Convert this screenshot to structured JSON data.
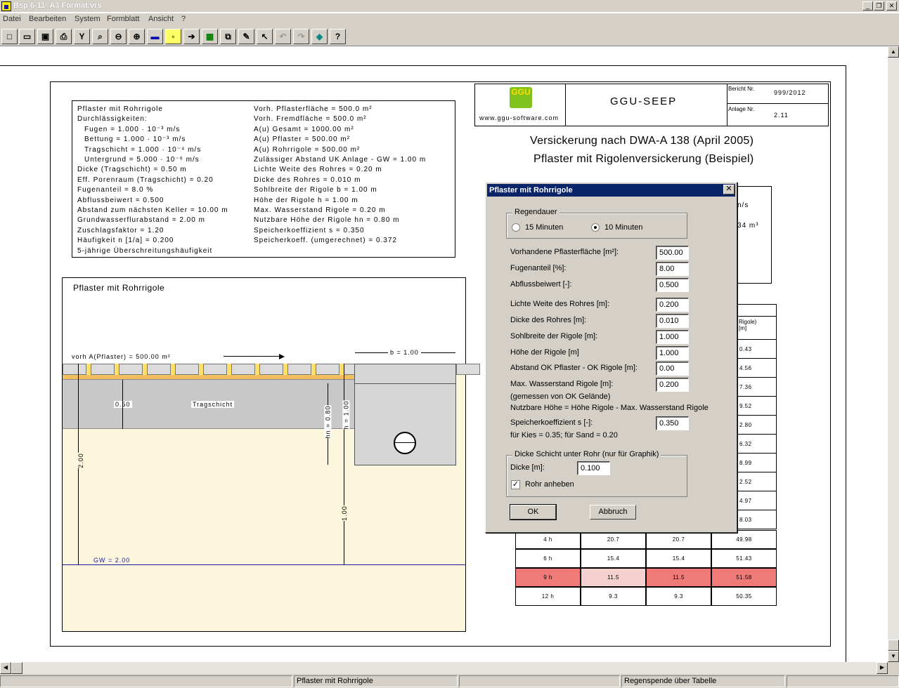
{
  "window": {
    "title": "Bsp 6-11_A3 Format.vrs"
  },
  "menu": [
    "Datei",
    "Bearbeiten",
    "System",
    "Formblatt",
    "Ansicht",
    "?"
  ],
  "report": {
    "logo_text": "GGU",
    "logo_url": "www.ggu-software.com",
    "program": "GGU-SEEP",
    "bericht_label": "Bericht Nr.",
    "bericht_value": "999/2012",
    "anlage_label": "Anlage Nr.",
    "anlage_value": "2.11",
    "heading1": "Versickerung nach DWA-A 138 (April 2005)",
    "heading2": "Pflaster mit Rigolenversickerung (Beispiel)"
  },
  "params_left": [
    "Pflaster mit Rohrrigole",
    "Durchlässigkeiten:",
    "Fugen = 1.000 · 10⁻³ m/s",
    "Bettung = 1.000 · 10⁻³ m/s",
    "Tragschicht = 1.000 · 10⁻⁴ m/s",
    "Untergrund = 5.000 · 10⁻⁶ m/s",
    "Dicke (Tragschicht) = 0.50 m",
    "Eff. Porenraum (Tragschicht) = 0.20",
    "Fugenanteil = 8.0 %",
    "Abflussbeiwert = 0.500",
    "Abstand zum nächsten Keller = 10.00 m",
    "Grundwasserflurabstand = 2.00 m",
    "Zuschlagsfaktor = 1.20",
    "Häufigkeit n [1/a] = 0.200",
    "5-jährige Überschreitungshäufigkeit"
  ],
  "params_right": [
    "Vorh. Pflasterfläche = 500.0 m²",
    "Vorh. Fremdfläche = 500.0 m²",
    "A(u) Gesamt = 1000.00 m²",
    "A(u) Pflaster = 500.00 m²",
    "A(u) Rohrrigole = 500.00 m²",
    "Zulässiger Abstand UK Anlage - GW = 1.00 m",
    "Lichte Weite des Rohres = 0.20 m",
    "Dicke des Rohres = 0.010 m",
    "Sohlbreite der Rigole b = 1.00 m",
    "Höhe der Rigole h = 1.00 m",
    "Max. Wasserstand Rigole = 0.20 m",
    "Nutzbare Höhe der Rigole hn = 0.80 m",
    "Speicherkoeffizient s = 0.350",
    "Speicherkoeff. (umgerechnet) = 0.372"
  ],
  "drawing": {
    "title": "Pflaster mit Rohrrigole",
    "area_label": "vorh A(Pflaster) = 500.00 m²",
    "b_label": "b = 1.00",
    "thick_label": "0.50",
    "layer_label": "Tragschicht",
    "hn_label": "hn = 0.80",
    "h_label": "h = 1.00",
    "depth_label": "2.00",
    "gap_label": "1.00",
    "gw_label": "GW = 2.00"
  },
  "right_box_partial": [
    "n/s",
    "34 m³"
  ],
  "table": {
    "header_partial": "Rigole)",
    "header_unit": "[m]",
    "hidden_col4": [
      "0.43",
      "4.56",
      "7.36",
      "9.52",
      "2.80",
      "6.32",
      "8.99",
      "2.52",
      "4.97",
      "8.03"
    ],
    "rows": [
      {
        "d": "4 h",
        "a": "20.7",
        "b": "20.7",
        "c": "49.98",
        "hl": false
      },
      {
        "d": "6 h",
        "a": "15.4",
        "b": "15.4",
        "c": "51.43",
        "hl": false
      },
      {
        "d": "9 h",
        "a": "11.5",
        "b": "11.5",
        "c": "51.58",
        "hl": true
      },
      {
        "d": "12 h",
        "a": "9.3",
        "b": "9.3",
        "c": "50.35",
        "hl": false
      }
    ]
  },
  "dialog": {
    "title": "Pflaster mit Rohrrigole",
    "group1": "Regendauer",
    "radio1": "15 Minuten",
    "radio2": "10 Minuten",
    "radio_selected": "10 Minuten",
    "fields": [
      {
        "label": "Vorhandene Pflasterfläche [m²]:",
        "value": "500.00"
      },
      {
        "label": "Fugenanteil [%]:",
        "value": "8.00"
      },
      {
        "label": "Abflussbeiwert [-]:",
        "value": "0.500"
      },
      {
        "label": "Lichte Weite des Rohres [m]:",
        "value": "0.200"
      },
      {
        "label": "Dicke des Rohres [m]:",
        "value": "0.010"
      },
      {
        "label": "Sohlbreite der Rigole [m]:",
        "value": "1.000"
      },
      {
        "label": "Höhe der Rigole [m]",
        "value": "1.000"
      },
      {
        "label": "Abstand OK Pflaster - OK Rigole [m]:",
        "value": "0.00"
      },
      {
        "label": "Max. Wasserstand Rigole [m]:",
        "value": "0.200"
      },
      {
        "label": "Speicherkoeffizient s [-]:",
        "value": "0.350"
      }
    ],
    "note1": "(gemessen von OK Gelände)",
    "note2": "Nutzbare Höhe = Höhe Rigole - Max. Wasserstand Rigole",
    "note3": "für Kies = 0.35; für Sand = 0.20",
    "group2": "Dicke Schicht unter Rohr (nur für Graphik)",
    "dicke_label": "Dicke [m]:",
    "dicke_value": "0.100",
    "checkbox_label": "Rohr anheben",
    "checkbox_checked": true,
    "ok": "OK",
    "cancel": "Abbruch"
  },
  "status": {
    "left": "Pflaster mit Rohrrigole",
    "right": "Regenspende über Tabelle"
  }
}
